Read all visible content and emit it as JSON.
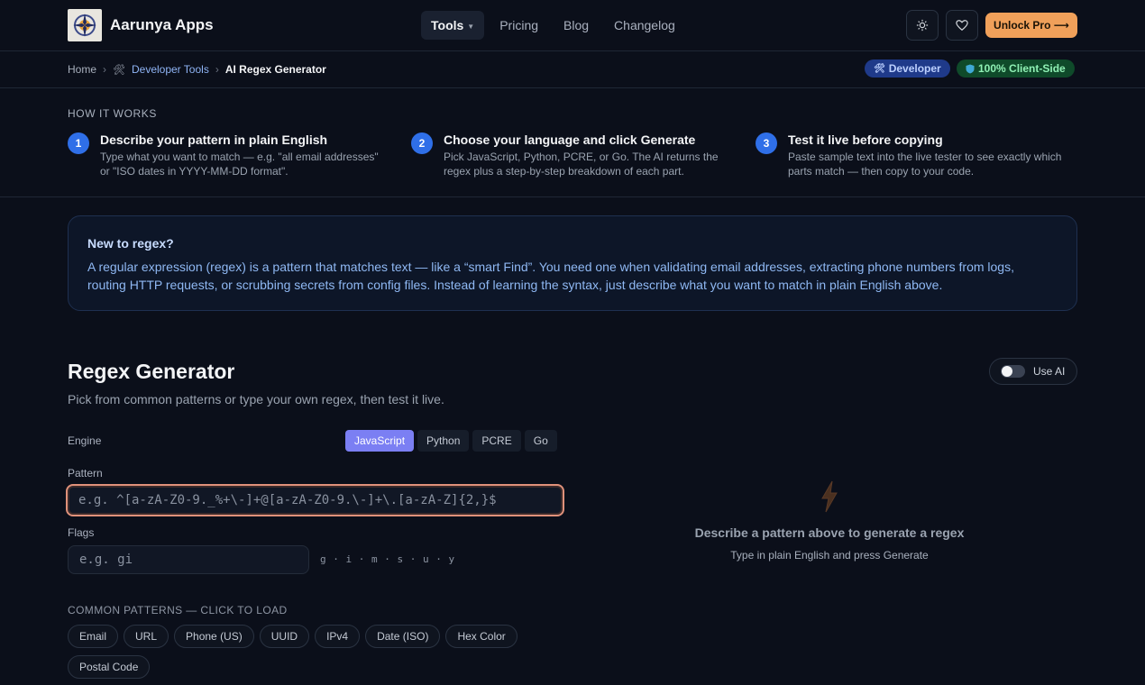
{
  "header": {
    "brand": "Aarunya Apps",
    "nav": [
      {
        "label": "Tools",
        "active": true
      },
      {
        "label": "Pricing",
        "active": false
      },
      {
        "label": "Blog",
        "active": false
      },
      {
        "label": "Changelog",
        "active": false
      }
    ],
    "icons": [
      "sun-icon",
      "heart-icon"
    ],
    "unlock_label": "Unlock Pro ⟶"
  },
  "breadcrumb": {
    "home": "Home",
    "category": "Developer Tools",
    "current": "AI Regex Generator",
    "badge_dev": "Developer",
    "badge_client": "100% Client-Side"
  },
  "how_it_works": {
    "title": "HOW IT WORKS",
    "steps": [
      {
        "num": "1",
        "title": "Describe your pattern in plain English",
        "desc": "Type what you want to match — e.g. \"all email addresses\" or \"ISO dates in YYYY-MM-DD format\"."
      },
      {
        "num": "2",
        "title": "Choose your language and click Generate",
        "desc": "Pick JavaScript, Python, PCRE, or Go. The AI returns the regex plus a step-by-step breakdown of each part."
      },
      {
        "num": "3",
        "title": "Test it live before copying",
        "desc": "Paste sample text into the live tester to see exactly which parts match — then copy to your code."
      }
    ]
  },
  "info": {
    "title": "New to regex?",
    "text": "A regular expression (regex) is a pattern that matches text — like a “smart Find”. You need one when validating email addresses, extracting phone numbers from logs, routing HTTP requests, or scrubbing secrets from config files. Instead of learning the syntax, just describe what you want to match in plain English above."
  },
  "generator": {
    "title": "Regex Generator",
    "subtitle": "Pick from common patterns or type your own regex, then test it live.",
    "toggle_label": "Use AI",
    "engine_label": "Engine",
    "engines": [
      "JavaScript",
      "Python",
      "PCRE",
      "Go"
    ],
    "active_engine": "JavaScript",
    "pattern_label": "Pattern",
    "pattern_placeholder": "e.g. ^[a-zA-Z0-9._%+\\-]+@[a-zA-Z0-9.\\-]+\\.[a-zA-Z]{2,}$",
    "pattern_value": "",
    "flags_label": "Flags",
    "flags_placeholder": "e.g. gi",
    "flags_hint": "g · i · m · s · u · y",
    "common_title": "COMMON PATTERNS — CLICK TO LOAD",
    "common_patterns": [
      "Email",
      "URL",
      "Phone (US)",
      "UUID",
      "IPv4",
      "Date (ISO)",
      "Hex Color",
      "Postal Code"
    ]
  },
  "empty_state": {
    "icon": "lightning-icon",
    "title": "Describe a pattern above to generate a regex",
    "subtitle": "Type in plain English and press Generate"
  },
  "colors": {
    "background": "#0b0f1a",
    "accent": "#7b7ff3",
    "unlock": "#f0a05a",
    "step": "#2f6fe8"
  }
}
